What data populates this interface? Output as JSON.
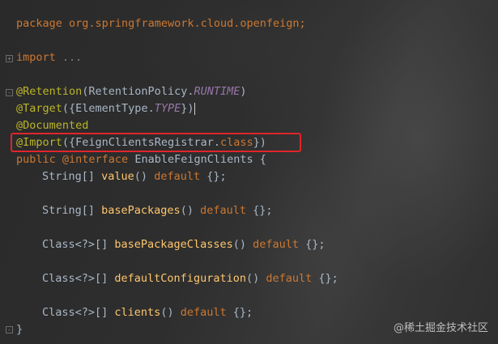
{
  "code": {
    "package_kw": "package",
    "package_name": " org.springframework.cloud.openfeign;",
    "import_kw": "import",
    "import_fold": " ...",
    "retention_ann": "@Retention",
    "retention_open": "(RetentionPolicy.",
    "retention_const": "RUNTIME",
    "retention_close": ")",
    "target_ann": "@Target",
    "target_open": "({ElementType.",
    "target_const": "TYPE",
    "target_close": "})",
    "documented_ann": "@Documented",
    "import_ann": "@Import",
    "import_open": "({FeignClientsRegistrar.",
    "import_class_kw": "class",
    "import_close": "})",
    "decl_public": "public ",
    "decl_interface": "@interface",
    "decl_name": " EnableFeignClients {",
    "m1_type": "String[] ",
    "m1_name": "value",
    "m1_parens": "() ",
    "m1_default": "default",
    "m1_tail": " {};",
    "m2_type": "String[] ",
    "m2_name": "basePackages",
    "m2_parens": "() ",
    "m2_default": "default",
    "m2_tail": " {};",
    "m3_type": "Class<?>[] ",
    "m3_name": "basePackageClasses",
    "m3_parens": "() ",
    "m3_default": "default",
    "m3_tail": " {};",
    "m4_type": "Class<?>[] ",
    "m4_name": "defaultConfiguration",
    "m4_parens": "() ",
    "m4_default": "default",
    "m4_tail": " {};",
    "m5_type": "Class<?>[] ",
    "m5_name": "clients",
    "m5_parens": "() ",
    "m5_default": "default",
    "m5_tail": " {};",
    "closing_brace": "}"
  },
  "gutter": {
    "fold_collapsed": "+",
    "fold_expanded": "-"
  },
  "watermark": "@稀土掘金技术社区",
  "colors": {
    "keyword": "#cc7832",
    "annotation": "#bbb529",
    "text": "#a9b7c6",
    "constant": "#9876aa",
    "highlight_box": "#e0252a"
  }
}
